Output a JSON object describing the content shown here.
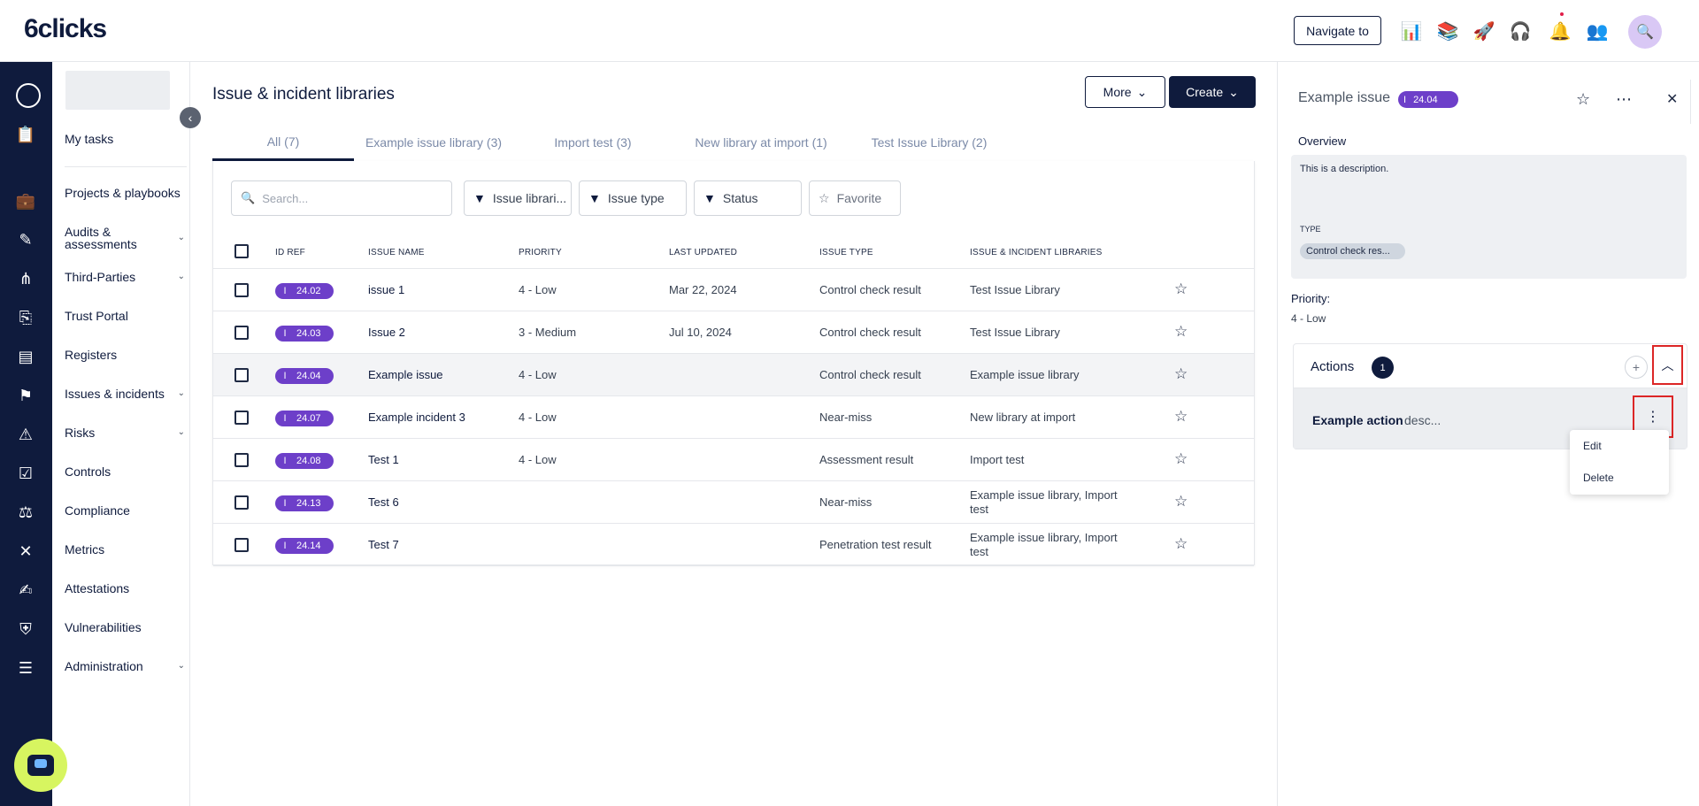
{
  "app": {
    "logo": "6clicks"
  },
  "topbar": {
    "navigate_label": "Navigate to",
    "icons": [
      "chart-icon",
      "library-icon",
      "rocket-icon",
      "support-icon",
      "bell-icon",
      "users-settings-icon"
    ],
    "avatar_icon": "search-avatar-icon"
  },
  "rail": {
    "icons": [
      "clipboard-icon",
      "briefcase-icon",
      "edit-icon",
      "network-icon",
      "portal-icon",
      "register-icon",
      "issue-icon",
      "warning-icon",
      "control-icon",
      "compliance-icon",
      "metrics-icon",
      "attestation-icon",
      "shield-icon",
      "sliders-icon"
    ]
  },
  "sidebar": {
    "my_tasks": "My tasks",
    "items": [
      {
        "label": "Projects & playbooks",
        "chevron": false
      },
      {
        "label": "Audits & assessments",
        "chevron": true
      },
      {
        "label": "Third-Parties",
        "chevron": true
      },
      {
        "label": "Trust Portal",
        "chevron": false
      },
      {
        "label": "Registers",
        "chevron": false
      },
      {
        "label": "Issues & incidents",
        "chevron": true
      },
      {
        "label": "Risks",
        "chevron": true
      },
      {
        "label": "Controls",
        "chevron": false
      },
      {
        "label": "Compliance",
        "chevron": false
      },
      {
        "label": "Metrics",
        "chevron": false
      },
      {
        "label": "Attestations",
        "chevron": false
      },
      {
        "label": "Vulnerabilities",
        "chevron": false
      },
      {
        "label": "Administration",
        "chevron": true
      }
    ]
  },
  "main": {
    "title": "Issue & incident libraries",
    "more_label": "More",
    "create_label": "Create",
    "tabs": [
      {
        "label": "All (7)",
        "active": true
      },
      {
        "label": "Example issue library (3)"
      },
      {
        "label": "Import test (3)"
      },
      {
        "label": "New library at import (1)"
      },
      {
        "label": "Test Issue Library (2)"
      }
    ],
    "search_placeholder": "Search...",
    "filters": [
      "Issue librari...",
      "Issue type",
      "Status"
    ],
    "favorite_label": "Favorite",
    "columns": [
      "ID REF",
      "ISSUE NAME",
      "PRIORITY",
      "LAST UPDATED",
      "ISSUE TYPE",
      "ISSUE & INCIDENT LIBRARIES"
    ],
    "badge_prefix": "I",
    "rows": [
      {
        "id": "24.02",
        "name": "issue 1",
        "priority": "4 - Low",
        "updated": "Mar 22, 2024",
        "type": "Control check result",
        "library": "Test Issue Library"
      },
      {
        "id": "24.03",
        "name": "Issue 2",
        "priority": "3 - Medium",
        "updated": "Jul 10, 2024",
        "type": "Control check result",
        "library": "Test Issue Library"
      },
      {
        "id": "24.04",
        "name": "Example issue",
        "priority": "4 - Low",
        "updated": "",
        "type": "Control check result",
        "library": "Example issue library"
      },
      {
        "id": "24.07",
        "name": "Example incident 3",
        "priority": "4 - Low",
        "updated": "",
        "type": "Near-miss",
        "library": "New library at import"
      },
      {
        "id": "24.08",
        "name": "Test 1",
        "priority": "4 - Low",
        "updated": "",
        "type": "Assessment result",
        "library": "Import test"
      },
      {
        "id": "24.13",
        "name": "Test 6",
        "priority": "",
        "updated": "",
        "type": "Near-miss",
        "library": "Example issue library, Import test"
      },
      {
        "id": "24.14",
        "name": "Test 7",
        "priority": "",
        "updated": "",
        "type": "Penetration test result",
        "library": "Example issue library, Import test"
      }
    ]
  },
  "detail": {
    "title": "Example issue",
    "badge_prefix": "I",
    "badge": "24.04",
    "overview_label": "Overview",
    "description": "This is a description.",
    "type_label": "TYPE",
    "type_value": "Control check res...",
    "priority_label": "Priority:",
    "priority_value": "4 - Low",
    "actions_label": "Actions",
    "actions_count": "1",
    "action_name": "Example action",
    "action_desc": "desc...",
    "menu": {
      "edit": "Edit",
      "delete": "Delete"
    }
  }
}
